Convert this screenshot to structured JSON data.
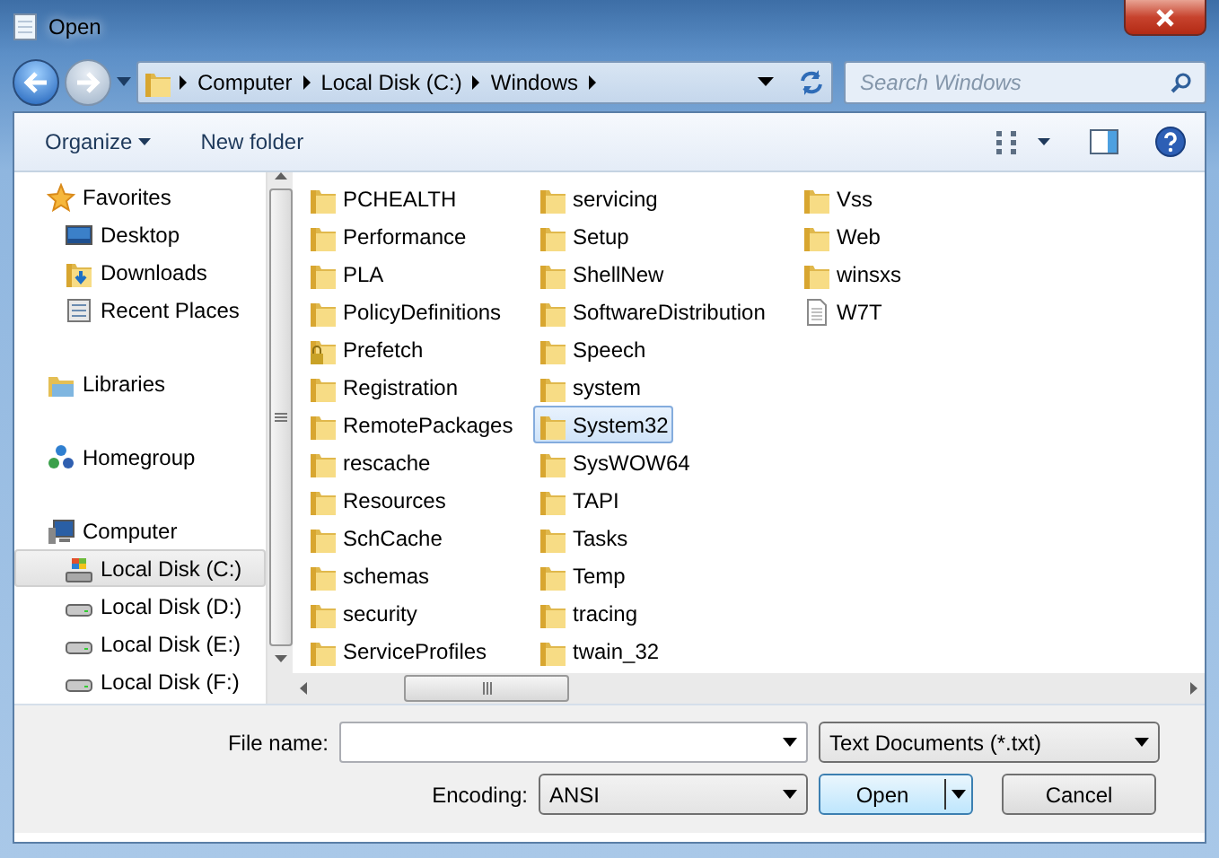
{
  "window": {
    "title": "Open"
  },
  "address": {
    "crumbs": [
      "Computer",
      "Local Disk (C:)",
      "Windows"
    ],
    "search_placeholder": "Search Windows"
  },
  "toolbar": {
    "organize": "Organize",
    "new_folder": "New folder"
  },
  "navigation": [
    {
      "label": "Favorites",
      "kind": "star",
      "selected": false,
      "children": [
        {
          "label": "Desktop",
          "kind": "desktop",
          "selected": false
        },
        {
          "label": "Downloads",
          "kind": "downloads",
          "selected": false
        },
        {
          "label": "Recent Places",
          "kind": "recent",
          "selected": false
        }
      ]
    },
    {
      "label": "Libraries",
      "kind": "libraries",
      "selected": false
    },
    {
      "label": "Homegroup",
      "kind": "homegroup",
      "selected": false
    },
    {
      "label": "Computer",
      "kind": "computer",
      "selected": false,
      "children": [
        {
          "label": "Local Disk (C:)",
          "kind": "systemdrive",
          "selected": true
        },
        {
          "label": "Local Disk (D:)",
          "kind": "drive",
          "selected": false
        },
        {
          "label": "Local Disk (E:)",
          "kind": "drive",
          "selected": false
        },
        {
          "label": "Local Disk (F:)",
          "kind": "drive",
          "selected": false
        }
      ]
    }
  ],
  "files": [
    {
      "name": "PCHEALTH",
      "kind": "folder",
      "selected": false
    },
    {
      "name": "Performance",
      "kind": "folder",
      "selected": false
    },
    {
      "name": "PLA",
      "kind": "folder",
      "selected": false
    },
    {
      "name": "PolicyDefinitions",
      "kind": "folder",
      "selected": false
    },
    {
      "name": "Prefetch",
      "kind": "locked",
      "selected": false
    },
    {
      "name": "Registration",
      "kind": "folder",
      "selected": false
    },
    {
      "name": "RemotePackages",
      "kind": "folder",
      "selected": false
    },
    {
      "name": "rescache",
      "kind": "folder",
      "selected": false
    },
    {
      "name": "Resources",
      "kind": "folder",
      "selected": false
    },
    {
      "name": "SchCache",
      "kind": "folder",
      "selected": false
    },
    {
      "name": "schemas",
      "kind": "folder",
      "selected": false
    },
    {
      "name": "security",
      "kind": "folder",
      "selected": false
    },
    {
      "name": "ServiceProfiles",
      "kind": "folder",
      "selected": false
    },
    {
      "name": "servicing",
      "kind": "folder",
      "selected": false
    },
    {
      "name": "Setup",
      "kind": "folder",
      "selected": false
    },
    {
      "name": "ShellNew",
      "kind": "folder",
      "selected": false
    },
    {
      "name": "SoftwareDistribution",
      "kind": "folder",
      "selected": false
    },
    {
      "name": "Speech",
      "kind": "folder",
      "selected": false
    },
    {
      "name": "system",
      "kind": "folder",
      "selected": false
    },
    {
      "name": "System32",
      "kind": "folder",
      "selected": true
    },
    {
      "name": "SysWOW64",
      "kind": "folder",
      "selected": false
    },
    {
      "name": "TAPI",
      "kind": "folder",
      "selected": false
    },
    {
      "name": "Tasks",
      "kind": "folder",
      "selected": false
    },
    {
      "name": "Temp",
      "kind": "folder",
      "selected": false
    },
    {
      "name": "tracing",
      "kind": "folder",
      "selected": false
    },
    {
      "name": "twain_32",
      "kind": "folder",
      "selected": false
    },
    {
      "name": "Vss",
      "kind": "folder",
      "selected": false
    },
    {
      "name": "Web",
      "kind": "folder",
      "selected": false
    },
    {
      "name": "winsxs",
      "kind": "folder",
      "selected": false
    },
    {
      "name": "W7T",
      "kind": "file",
      "selected": false
    }
  ],
  "bottom": {
    "file_name_label": "File name:",
    "filter": "Text Documents (*.txt)",
    "encoding_label": "Encoding:",
    "encoding": "ANSI",
    "open": "Open",
    "cancel": "Cancel"
  }
}
